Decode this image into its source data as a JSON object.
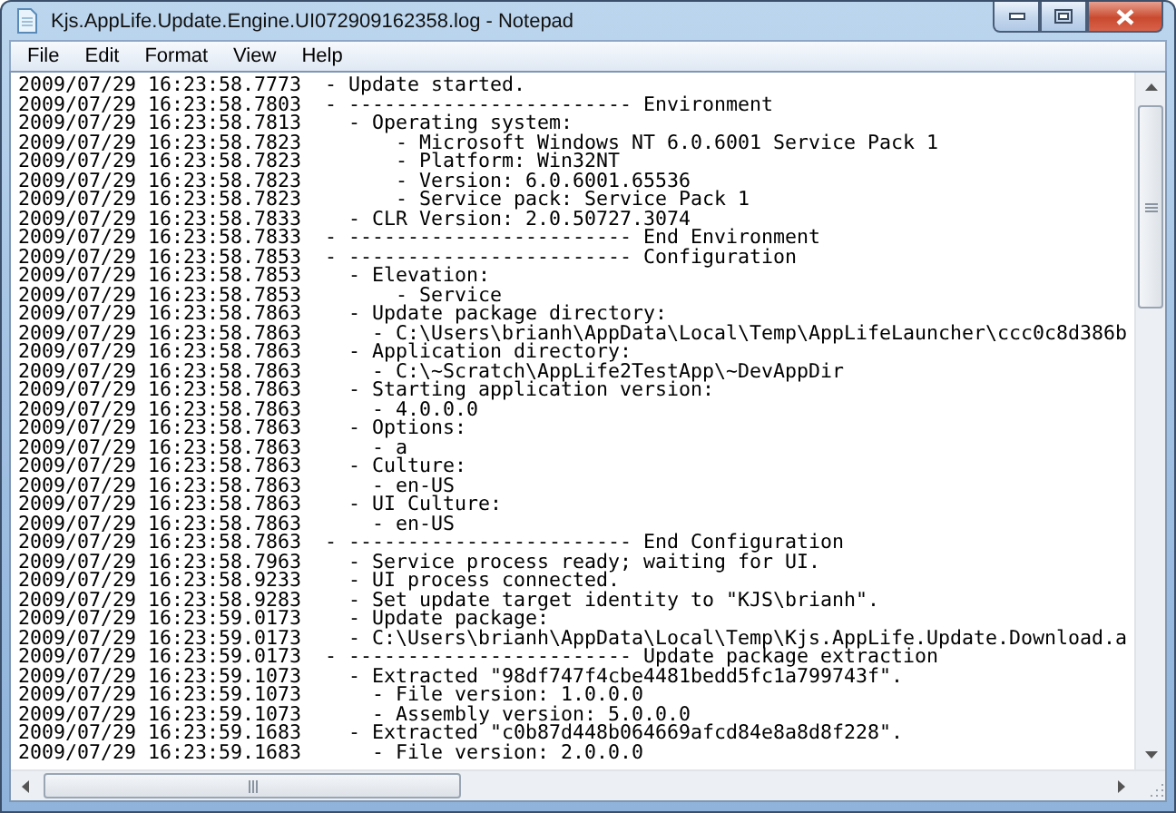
{
  "window": {
    "title": "Kjs.AppLife.Update.Engine.UI072909162358.log - Notepad"
  },
  "menu": [
    "File",
    "Edit",
    "Format",
    "View",
    "Help"
  ],
  "lines": [
    {
      "time": "2009/07/29 16:23:58.7773",
      "message": "- Update started."
    },
    {
      "time": "2009/07/29 16:23:58.7803",
      "message": "- ------------------------ Environment"
    },
    {
      "time": "2009/07/29 16:23:58.7813",
      "message": "  - Operating system:"
    },
    {
      "time": "2009/07/29 16:23:58.7823",
      "message": "      - Microsoft Windows NT 6.0.6001 Service Pack 1"
    },
    {
      "time": "2009/07/29 16:23:58.7823",
      "message": "      - Platform: Win32NT"
    },
    {
      "time": "2009/07/29 16:23:58.7823",
      "message": "      - Version: 6.0.6001.65536"
    },
    {
      "time": "2009/07/29 16:23:58.7823",
      "message": "      - Service pack: Service Pack 1"
    },
    {
      "time": "2009/07/29 16:23:58.7833",
      "message": "  - CLR Version: 2.0.50727.3074"
    },
    {
      "time": "2009/07/29 16:23:58.7833",
      "message": "- ------------------------ End Environment"
    },
    {
      "time": "2009/07/29 16:23:58.7853",
      "message": "- ------------------------ Configuration"
    },
    {
      "time": "2009/07/29 16:23:58.7853",
      "message": "  - Elevation:"
    },
    {
      "time": "2009/07/29 16:23:58.7853",
      "message": "      - Service"
    },
    {
      "time": "2009/07/29 16:23:58.7863",
      "message": "  - Update package directory:"
    },
    {
      "time": "2009/07/29 16:23:58.7863",
      "message": "    - C:\\Users\\brianh\\AppData\\Local\\Temp\\AppLifeLauncher\\ccc0c8d386b"
    },
    {
      "time": "2009/07/29 16:23:58.7863",
      "message": "  - Application directory:"
    },
    {
      "time": "2009/07/29 16:23:58.7863",
      "message": "    - C:\\~Scratch\\AppLife2TestApp\\~DevAppDir"
    },
    {
      "time": "2009/07/29 16:23:58.7863",
      "message": "  - Starting application version:"
    },
    {
      "time": "2009/07/29 16:23:58.7863",
      "message": "    - 4.0.0.0"
    },
    {
      "time": "2009/07/29 16:23:58.7863",
      "message": "  - Options:"
    },
    {
      "time": "2009/07/29 16:23:58.7863",
      "message": "    - a"
    },
    {
      "time": "2009/07/29 16:23:58.7863",
      "message": "  - Culture:"
    },
    {
      "time": "2009/07/29 16:23:58.7863",
      "message": "    - en-US"
    },
    {
      "time": "2009/07/29 16:23:58.7863",
      "message": "  - UI Culture:"
    },
    {
      "time": "2009/07/29 16:23:58.7863",
      "message": "    - en-US"
    },
    {
      "time": "2009/07/29 16:23:58.7863",
      "message": "- ------------------------ End Configuration"
    },
    {
      "time": "2009/07/29 16:23:58.7963",
      "message": "  - Service process ready; waiting for UI."
    },
    {
      "time": "2009/07/29 16:23:58.9233",
      "message": "  - UI process connected."
    },
    {
      "time": "2009/07/29 16:23:58.9283",
      "message": "  - Set update target identity to \"KJS\\brianh\"."
    },
    {
      "time": "2009/07/29 16:23:59.0173",
      "message": "  - Update package:"
    },
    {
      "time": "2009/07/29 16:23:59.0173",
      "message": "  - C:\\Users\\brianh\\AppData\\Local\\Temp\\Kjs.AppLife.Update.Download.a"
    },
    {
      "time": "2009/07/29 16:23:59.0173",
      "message": "- ------------------------ Update package extraction"
    },
    {
      "time": "2009/07/29 16:23:59.1073",
      "message": "  - Extracted \"98df747f4cbe4481bedd5fc1a799743f\"."
    },
    {
      "time": "2009/07/29 16:23:59.1073",
      "message": "    - File version: 1.0.0.0"
    },
    {
      "time": "2009/07/29 16:23:59.1073",
      "message": "    - Assembly version: 5.0.0.0"
    },
    {
      "time": "2009/07/29 16:23:59.1683",
      "message": "  - Extracted \"c0b87d448b064669afcd84e8a8d8f228\"."
    },
    {
      "time": "2009/07/29 16:23:59.1683",
      "message": "    - File version: 2.0.0.0"
    }
  ]
}
